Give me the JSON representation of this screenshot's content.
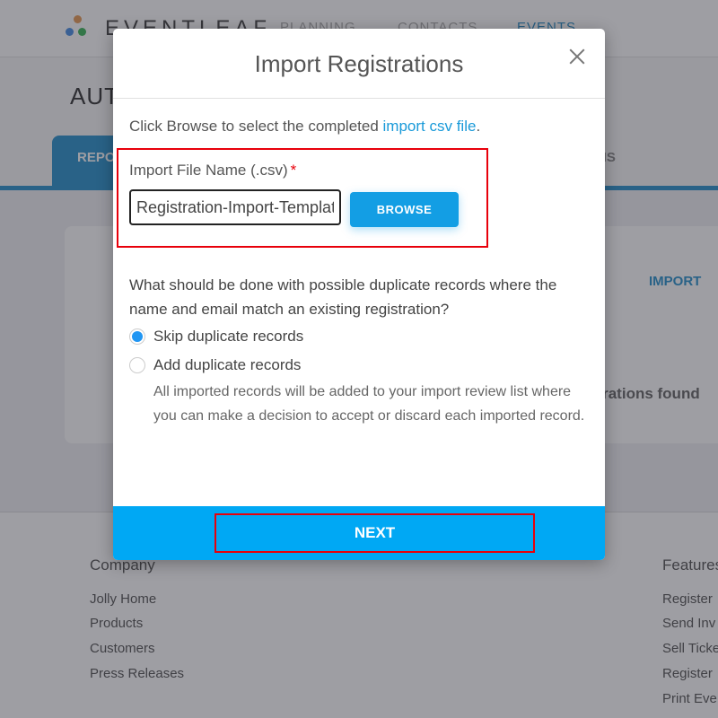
{
  "app": {
    "brand": "EVENTLEAF",
    "nav": [
      {
        "label": "PLANNING"
      },
      {
        "label": "CONTACTS"
      },
      {
        "label": "EVENTS",
        "active": true
      }
    ]
  },
  "page": {
    "title": "AUT",
    "tabs": [
      {
        "label": "REPO",
        "active": true
      },
      {
        "label": "TIONS"
      }
    ],
    "card": {
      "import_label": "IMPORT",
      "empty_text": "strations found"
    }
  },
  "footer": {
    "columns": [
      {
        "heading": "Company",
        "links": [
          "Jolly Home",
          "Products",
          "Customers",
          "Press Releases"
        ]
      },
      {
        "heading": "Features",
        "links": [
          "Register",
          "Send Inv",
          "Sell Ticke",
          "Register",
          "Print Eve"
        ]
      }
    ]
  },
  "modal": {
    "title": "Import Registrations",
    "intro_text": "Click Browse to select the completed ",
    "intro_link": "import csv file",
    "intro_suffix": ".",
    "file_field": {
      "label": "Import File Name (.csv)",
      "required_mark": "*",
      "value": "Registration-Import-Templat"
    },
    "browse_label": "BROWSE",
    "question": "What should be done with possible duplicate records where the name and email match an existing registration?",
    "options": [
      {
        "label": "Skip duplicate records",
        "checked": true
      },
      {
        "label": "Add duplicate records",
        "checked": false
      }
    ],
    "add_help": "All imported records will be added to your import review list where you can make a decision to accept or discard each imported record.",
    "next_label": "NEXT"
  },
  "colors": {
    "accent": "#00a8f4",
    "button": "#139ee4",
    "link": "#1a9ad9",
    "highlight": "#e8000b",
    "tab": "#2a92cc"
  }
}
